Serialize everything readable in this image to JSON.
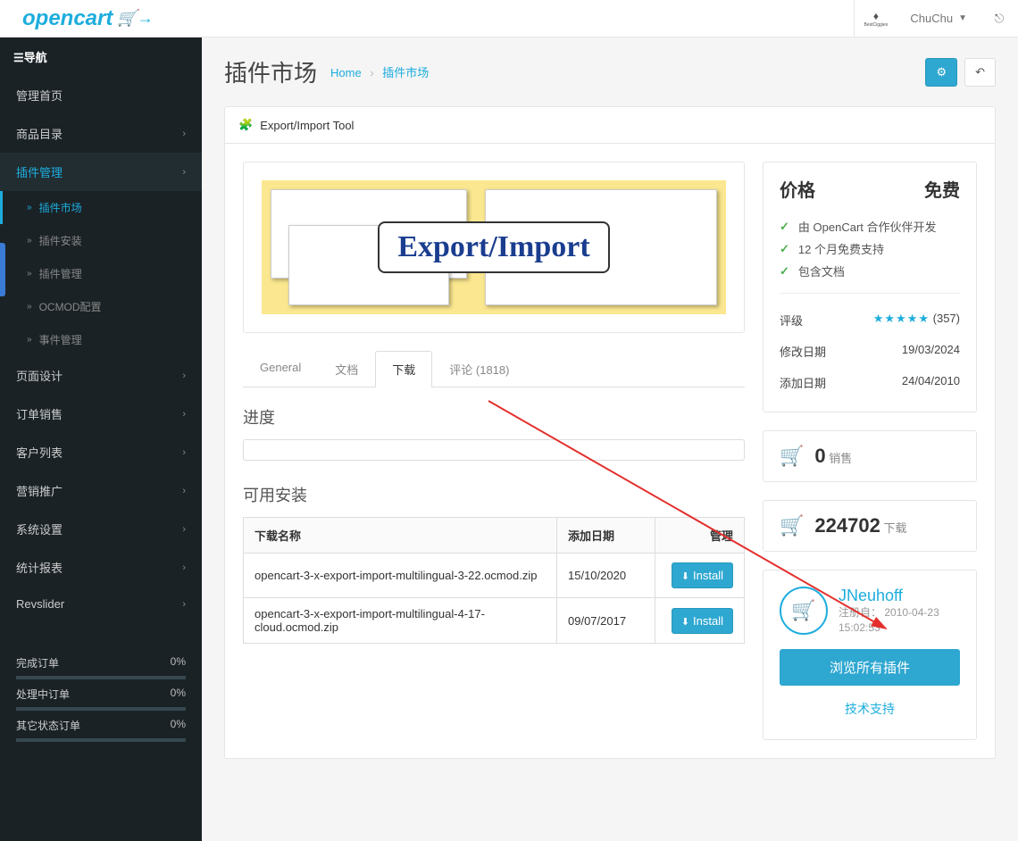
{
  "topbar": {
    "logo_text": "opencart",
    "user_name": "ChuChu",
    "brand_text": "BestCiggies"
  },
  "sidebar": {
    "nav_label": "☰导航",
    "items": [
      {
        "label": "管理首页",
        "expandable": false
      },
      {
        "label": "商品目录",
        "expandable": true
      },
      {
        "label": "插件管理",
        "expandable": true,
        "active": true
      },
      {
        "label": "页面设计",
        "expandable": true
      },
      {
        "label": "订单销售",
        "expandable": true
      },
      {
        "label": "客户列表",
        "expandable": true
      },
      {
        "label": "营销推广",
        "expandable": true
      },
      {
        "label": "系统设置",
        "expandable": true
      },
      {
        "label": "统计报表",
        "expandable": true
      },
      {
        "label": "Revslider",
        "expandable": true
      }
    ],
    "sub_items": [
      {
        "label": "插件市场",
        "active": true
      },
      {
        "label": "插件安装",
        "active": false
      },
      {
        "label": "插件管理",
        "active": false
      },
      {
        "label": "OCMOD配置",
        "active": false
      },
      {
        "label": "事件管理",
        "active": false
      }
    ],
    "stats": [
      {
        "label": "完成订单",
        "value": "0%"
      },
      {
        "label": "处理中订单",
        "value": "0%"
      },
      {
        "label": "其它状态订单",
        "value": "0%"
      }
    ]
  },
  "page": {
    "title": "插件市场",
    "bc_home": "Home",
    "bc_current": "插件市场"
  },
  "panel": {
    "heading": "Export/Import Tool",
    "hero_text": "Export/Import"
  },
  "tabs": {
    "general": "General",
    "docs": "文档",
    "download": "下载",
    "comments": "评论 (1818)"
  },
  "download": {
    "progress_h": "进度",
    "available_h": "可用安装",
    "th_name": "下载名称",
    "th_date": "添加日期",
    "th_action": "管理",
    "install_label": "Install",
    "rows": [
      {
        "name": "opencart-3-x-export-import-multilingual-3-22.ocmod.zip",
        "date": "15/10/2020"
      },
      {
        "name": "opencart-3-x-export-import-multilingual-4-17-cloud.ocmod.zip",
        "date": "09/07/2017"
      }
    ]
  },
  "info": {
    "price_label": "价格",
    "price_value": "免费",
    "checks": [
      "由 OpenCart 合作伙伴开发",
      "12 个月免费支持",
      "包含文档"
    ],
    "rating_label": "评级",
    "rating_count": "(357)",
    "modified_label": "修改日期",
    "modified_value": "19/03/2024",
    "added_label": "添加日期",
    "added_value": "24/04/2010"
  },
  "stats": {
    "sales_num": "0",
    "sales_label": "销售",
    "downloads_num": "224702",
    "downloads_label": "下载"
  },
  "author": {
    "name": "JNeuhoff",
    "meta_prefix": "注册自：",
    "meta_date": "2010-04-23",
    "meta_time": "15:02:53",
    "browse_btn": "浏览所有插件",
    "support_link": "技术支持"
  }
}
